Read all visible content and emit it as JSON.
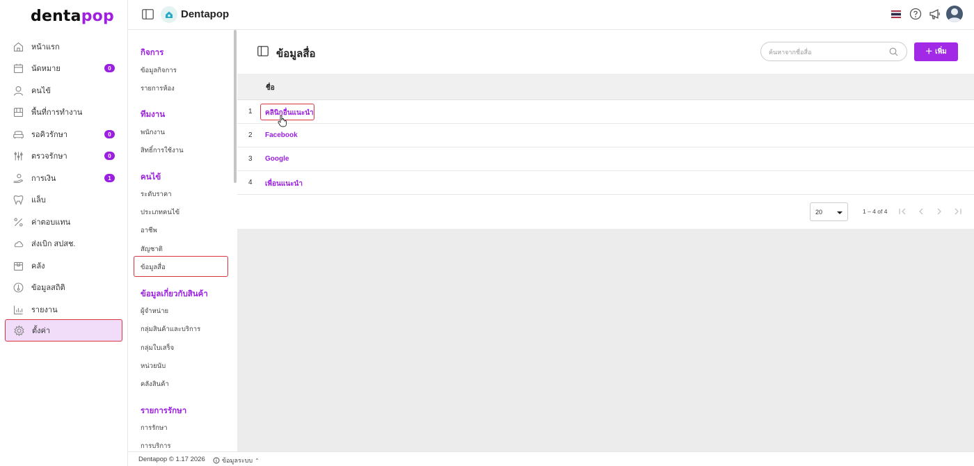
{
  "brand": {
    "logo_part1": "denta",
    "logo_part2": "pop"
  },
  "header": {
    "app_title": "Dentapop"
  },
  "sidebar": {
    "items": [
      {
        "label": "หน้าแรก",
        "icon": "home-icon"
      },
      {
        "label": "นัดหมาย",
        "icon": "calendar-icon",
        "badge": "0"
      },
      {
        "label": "คนไข้",
        "icon": "user-icon"
      },
      {
        "label": "พื้นที่การทำงาน",
        "icon": "workspace-icon"
      },
      {
        "label": "รอคิวรักษา",
        "icon": "sofa-icon",
        "badge": "0"
      },
      {
        "label": "ตรวจรักษา",
        "icon": "tools-icon",
        "badge": "0"
      },
      {
        "label": "การเงิน",
        "icon": "money-hand-icon",
        "badge": "1"
      },
      {
        "label": "แล็บ",
        "icon": "tooth-icon"
      },
      {
        "label": "ค่าตอบแทน",
        "icon": "percent-icon"
      },
      {
        "label": "ส่งเบิก สปสช.",
        "icon": "cloud-icon"
      },
      {
        "label": "คลัง",
        "icon": "box-icon"
      },
      {
        "label": "ข้อมูลสถิติ",
        "icon": "thermometer-icon"
      },
      {
        "label": "รายงาน",
        "icon": "chart-icon"
      },
      {
        "label": "ตั้งค่า",
        "icon": "gear-icon"
      }
    ]
  },
  "submenu": {
    "sections": [
      {
        "heading": "กิจการ",
        "items": [
          "ข้อมูลกิจการ",
          "รายการห้อง"
        ]
      },
      {
        "heading": "ทีมงาน",
        "items": [
          "พนักงาน",
          "สิทธิ์การใช้งาน"
        ]
      },
      {
        "heading": "คนไข้",
        "items": [
          "ระดับราคา",
          "ประเภทคนไข้",
          "อาชีพ",
          "สัญชาติ",
          "ข้อมูลสื่อ"
        ]
      },
      {
        "heading": "ข้อมูลเกี่ยวกับสินค้า",
        "items": [
          "ผู้จำหน่าย",
          "กลุ่มสินค้าและบริการ",
          "กลุ่มใบเสร็จ",
          "หน่วยนับ",
          "คลังสินค้า"
        ]
      },
      {
        "heading": "รายการรักษา",
        "items": [
          "การรักษา",
          "การบริการ"
        ]
      }
    ]
  },
  "main": {
    "title": "ข้อมูลสื่อ",
    "search_placeholder": "ค้นหาจากชื่อสื่อ",
    "add_label": "เพิ่ม",
    "column_name": "ชื่อ",
    "rows": [
      {
        "num": "1",
        "name": "คลินิกอื่นแนะนำ"
      },
      {
        "num": "2",
        "name": "Facebook"
      },
      {
        "num": "3",
        "name": "Google"
      },
      {
        "num": "4",
        "name": "เพื่อนแนะนำ"
      }
    ],
    "page_size": "20",
    "range_label": "1 – 4 of 4"
  },
  "footer": {
    "text": "Dentapop © 1.17 2026",
    "info_label": "ข้อมูลระบบ"
  },
  "colors": {
    "accent": "#9b1fe0",
    "highlight_border": "#d9343f"
  }
}
